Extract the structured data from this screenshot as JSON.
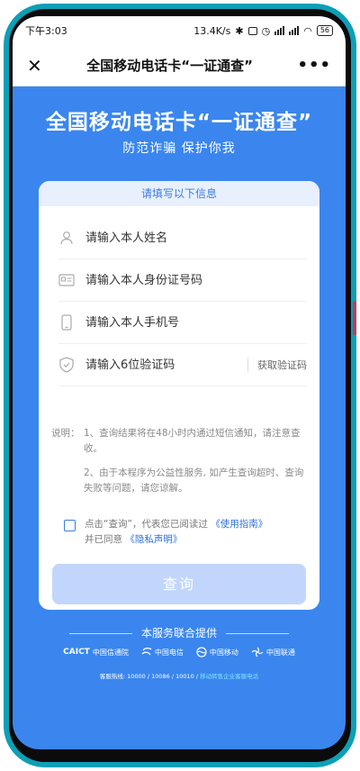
{
  "status": {
    "time": "下午3:03",
    "speed": "13.4K/s",
    "battery": "56"
  },
  "navbar": {
    "title": "全国移动电话卡“一证通查”",
    "close_icon": "close-icon",
    "more_icon": "more-icon"
  },
  "hero": {
    "title": "全国移动电话卡“一证通查”",
    "subtitle": "防范诈骗 保护你我"
  },
  "form": {
    "tab_label": "请填写以下信息",
    "name_placeholder": "请输入本人姓名",
    "id_placeholder": "请输入本人身份证号码",
    "phone_placeholder": "请输入本人手机号",
    "code_placeholder": "请输入6位验证码",
    "get_code_label": "获取验证码"
  },
  "notes": {
    "label": "说明：",
    "item1": "1、查询结果将在48小时内通过短信通知，请注意查收。",
    "item2": "2、由于本程序为公益性服务, 如产生查询超时、查询失败等问题，请您谅解。"
  },
  "agreement": {
    "prefix": "点击“查询”，代表您已阅读过",
    "guide_link": "《使用指南》",
    "middle": "并已同意",
    "privacy_link": "《隐私声明》"
  },
  "submit_label": "查询",
  "footer": {
    "title": "本服务联合提供",
    "logos": [
      {
        "mark": "CAICT",
        "name": "中国信通院"
      },
      {
        "mark": "",
        "name": "中国电信"
      },
      {
        "mark": "",
        "name": "中国移动"
      },
      {
        "mark": "",
        "name": "中国联通"
      }
    ],
    "hotline_prefix": "客服热线: 10000 / 10086 / 10010 /",
    "hotline_link": "移动转售企业客服电话"
  },
  "colors": {
    "background": "#3a86ee",
    "accent": "#3a7be0",
    "submit_disabled": "#c1d6fa"
  }
}
